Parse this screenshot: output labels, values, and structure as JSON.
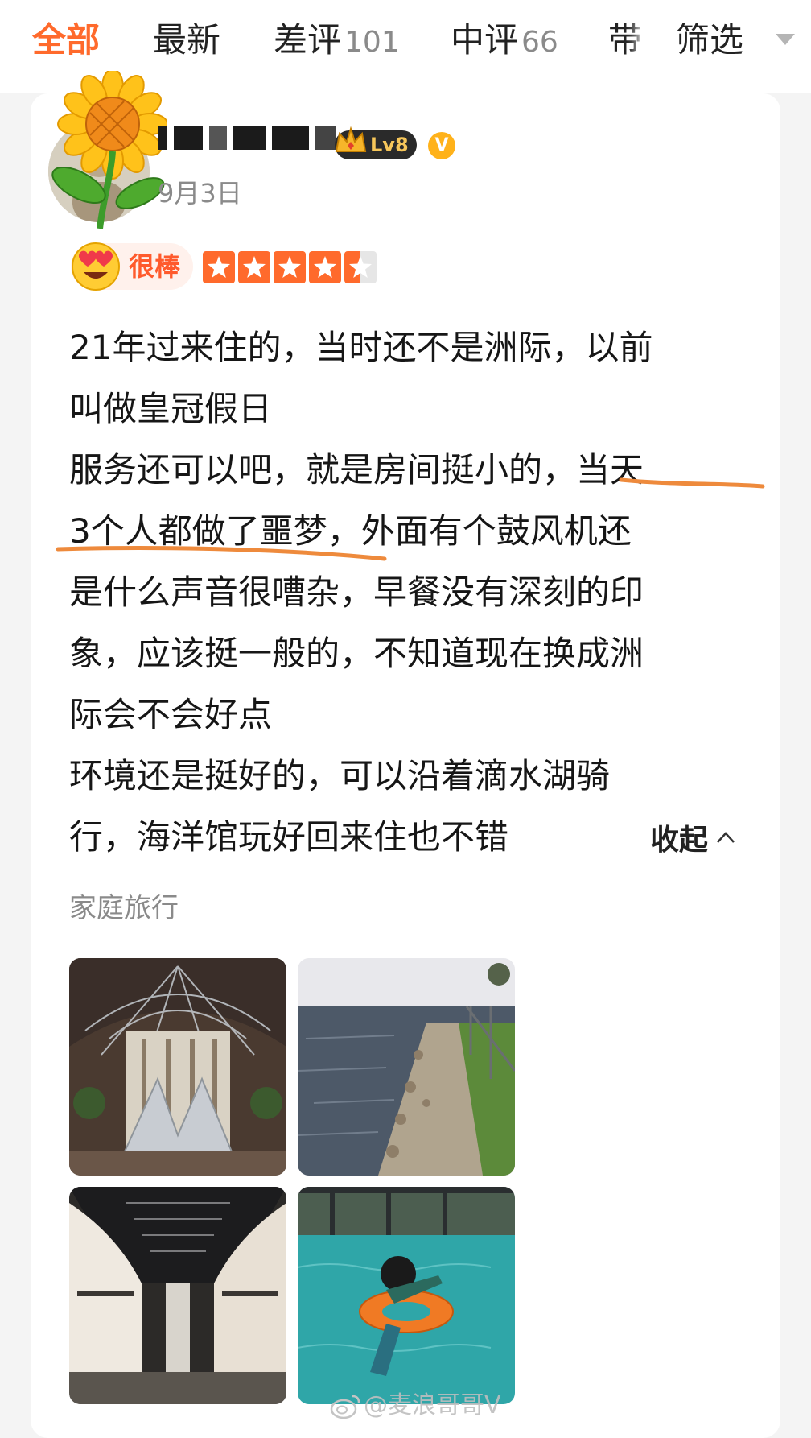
{
  "tabs": [
    {
      "label": "全部",
      "count": ""
    },
    {
      "label": "最新",
      "count": ""
    },
    {
      "label": "差评",
      "count": "101"
    },
    {
      "label": "中评",
      "count": "66"
    },
    {
      "label": "带",
      "count": ""
    }
  ],
  "filter": {
    "label": "筛选"
  },
  "review": {
    "level_badge": "Lv8",
    "verified_badge": "V",
    "date": "9月3日",
    "rating_label": "很棒",
    "rating_stars": 4.5,
    "lines": [
      "21年过来住的，当时还不是洲际，以前",
      "叫做皇冠假日",
      "服务还可以吧，就是房间挺小的，当天",
      "3个人都做了噩梦，外面有个鼓风机还",
      "是什么声音很嘈杂，早餐没有深刻的印",
      "象，应该挺一般的，不知道现在换成洲",
      "际会不会好点",
      "环境还是挺好的，可以沿着滴水湖骑",
      "行，海洋馆玩好回来住也不错"
    ],
    "collapse_label": "收起",
    "tag": "家庭旅行"
  },
  "watermark": "@麦浪哥哥V",
  "colors": {
    "accent": "#ff6a2c",
    "underline": "#ee8a3c"
  }
}
